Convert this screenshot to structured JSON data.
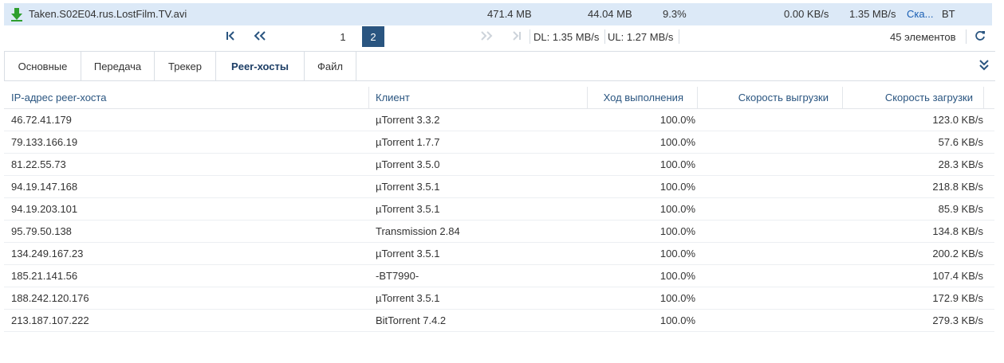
{
  "download": {
    "name": "Taken.S02E04.rus.LostFilm.TV.avi",
    "size": "471.4 MB",
    "downloaded": "44.04 MB",
    "progress": "9.3%",
    "upload_speed": "0.00 KB/s",
    "download_speed": "1.35 MB/s",
    "status": "Ска...",
    "type": "BT"
  },
  "pager": {
    "pages": [
      "1",
      "2"
    ],
    "active_page": "2",
    "dl_rate": "DL: 1.35 MB/s",
    "ul_rate": "UL: 1.27 MB/s",
    "total_items": "45 элементов"
  },
  "tabs": [
    "Основные",
    "Передача",
    "Трекер",
    "Peer-хосты",
    "Файл"
  ],
  "active_tab": "Peer-хосты",
  "table": {
    "columns": [
      "IP-адрес peer-хоста",
      "Клиент",
      "Ход выполнения",
      "Скорость выгрузки",
      "Скорость загрузки"
    ],
    "rows": [
      [
        "46.72.41.179",
        "µTorrent 3.3.2",
        "100.0%",
        "",
        "123.0 KB/s"
      ],
      [
        "79.133.166.19",
        "µTorrent 1.7.7",
        "100.0%",
        "",
        "57.6 KB/s"
      ],
      [
        "81.22.55.73",
        "µTorrent 3.5.0",
        "100.0%",
        "",
        "28.3 KB/s"
      ],
      [
        "94.19.147.168",
        "µTorrent 3.5.1",
        "100.0%",
        "",
        "218.8 KB/s"
      ],
      [
        "94.19.203.101",
        "µTorrent 3.5.1",
        "100.0%",
        "",
        "85.9 KB/s"
      ],
      [
        "95.79.50.138",
        "Transmission 2.84",
        "100.0%",
        "",
        "134.8 KB/s"
      ],
      [
        "134.249.167.23",
        "µTorrent 3.5.1",
        "100.0%",
        "",
        "200.2 KB/s"
      ],
      [
        "185.21.141.56",
        "-BT7990-",
        "100.0%",
        "",
        "107.4 KB/s"
      ],
      [
        "188.242.120.176",
        "µTorrent 3.5.1",
        "100.0%",
        "",
        "172.9 KB/s"
      ],
      [
        "213.187.107.222",
        "BitTorrent 7.4.2",
        "100.0%",
        "",
        "279.3 KB/s"
      ]
    ]
  },
  "colors": {
    "accent": "#2a5580",
    "selected_row": "#dce9f7",
    "download_icon": "#2e9e2e",
    "status_link": "#1a5fb4"
  },
  "icons": [
    "download-arrow-icon",
    "first-page-icon",
    "prev-pages-icon",
    "next-pages-icon",
    "last-page-icon",
    "refresh-icon",
    "collapse-icon"
  ]
}
